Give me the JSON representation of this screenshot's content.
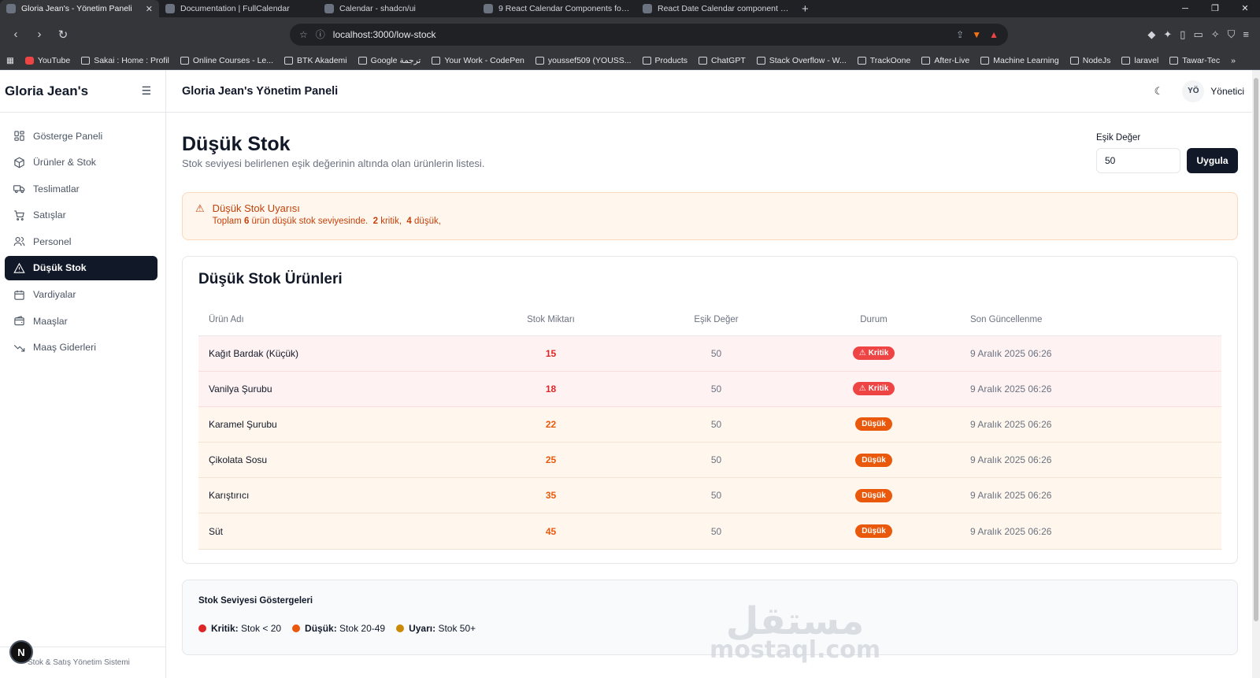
{
  "browser": {
    "tabs": [
      {
        "title": "Gloria Jean's - Yönetim Paneli",
        "active": true,
        "favicon": "globe-icon"
      },
      {
        "title": "Documentation | FullCalendar",
        "active": false,
        "favicon": "calendar-icon"
      },
      {
        "title": "Calendar - shadcn/ui",
        "active": false,
        "favicon": "shadcn-icon"
      },
      {
        "title": "9 React Calendar Components for Yo",
        "active": false,
        "favicon": "dev-icon"
      },
      {
        "title": "React Date Calendar component - M",
        "active": false,
        "favicon": "mui-icon"
      }
    ],
    "url": "localhost:3000/low-stock",
    "bookmarks": [
      "YouTube",
      "Sakai : Home : Profil",
      "Online Courses - Le...",
      "BTK Akademi",
      "Google ترجمة",
      "Your Work - CodePen",
      "youssef509 (YOUSS...",
      "Products",
      "ChatGPT",
      "Stack Overflow - W...",
      "TrackOone",
      "After-Live",
      "Machine Learning",
      "NodeJs",
      "laravel",
      "Tawar-Tec"
    ]
  },
  "sidebar": {
    "brand": "Gloria Jean's",
    "items": [
      {
        "label": "Gösterge Paneli",
        "icon": "dashboard-icon",
        "active": false
      },
      {
        "label": "Ürünler & Stok",
        "icon": "package-icon",
        "active": false
      },
      {
        "label": "Teslimatlar",
        "icon": "truck-icon",
        "active": false
      },
      {
        "label": "Satışlar",
        "icon": "cart-icon",
        "active": false
      },
      {
        "label": "Personel",
        "icon": "users-icon",
        "active": false
      },
      {
        "label": "Düşük Stok",
        "icon": "alert-triangle-icon",
        "active": true
      },
      {
        "label": "Vardiyalar",
        "icon": "calendar-icon",
        "active": false
      },
      {
        "label": "Maaşlar",
        "icon": "wallet-icon",
        "active": false
      },
      {
        "label": "Maaş Giderleri",
        "icon": "trending-down-icon",
        "active": false
      }
    ],
    "footer": "Stok & Satış Yönetim Sistemi",
    "badge": "N"
  },
  "topbar": {
    "title": "Gloria Jean's Yönetim Paneli",
    "avatar": "YÖ",
    "role": "Yönetici"
  },
  "page": {
    "title": "Düşük Stok",
    "subtitle": "Stok seviyesi belirlenen eşik değerinin altında olan ürünlerin listesi.",
    "threshold_label": "Eşik Değer",
    "threshold_value": "50",
    "apply_label": "Uygula"
  },
  "alert": {
    "title": "Düşük Stok Uyarısı",
    "prefix": "Toplam ",
    "total": "6",
    "middle": " ürün düşük stok seviyesinde.",
    "critical": "2",
    "critical_word": " kritik,",
    "low": "4",
    "low_word": " düşük,"
  },
  "table": {
    "title": "Düşük Stok Ürünleri",
    "headers": [
      "Ürün Adı",
      "Stok Miktarı",
      "Eşik Değer",
      "Durum",
      "Son Güncellenme"
    ],
    "rows": [
      {
        "name": "Kağıt Bardak (Küçük)",
        "stock": "15",
        "threshold": "50",
        "status": "Kritik",
        "level": "kritik",
        "updated": "9 Aralık 2025 06:26"
      },
      {
        "name": "Vanilya Şurubu",
        "stock": "18",
        "threshold": "50",
        "status": "Kritik",
        "level": "kritik",
        "updated": "9 Aralık 2025 06:26"
      },
      {
        "name": "Karamel Şurubu",
        "stock": "22",
        "threshold": "50",
        "status": "Düşük",
        "level": "dusuk",
        "updated": "9 Aralık 2025 06:26"
      },
      {
        "name": "Çikolata Sosu",
        "stock": "25",
        "threshold": "50",
        "status": "Düşük",
        "level": "dusuk",
        "updated": "9 Aralık 2025 06:26"
      },
      {
        "name": "Karıştırıcı",
        "stock": "35",
        "threshold": "50",
        "status": "Düşük",
        "level": "dusuk",
        "updated": "9 Aralık 2025 06:26"
      },
      {
        "name": "Süt",
        "stock": "45",
        "threshold": "50",
        "status": "Düşük",
        "level": "dusuk",
        "updated": "9 Aralık 2025 06:26"
      }
    ]
  },
  "legend": {
    "title": "Stok Seviyesi Göstergeleri",
    "items": [
      {
        "label": "Kritik:",
        "desc": " Stok < 20",
        "color": "#dc2626"
      },
      {
        "label": "Düşük:",
        "desc": " Stok 20-49",
        "color": "#ea580c"
      },
      {
        "label": "Uyarı:",
        "desc": " Stok 50+",
        "color": "#ca8a04"
      }
    ]
  },
  "watermark": {
    "arabic": "مستقل",
    "latin": "mostaql.com"
  },
  "colors": {
    "accent": "#111827",
    "critical": "#ef4444",
    "low": "#ea580c"
  }
}
